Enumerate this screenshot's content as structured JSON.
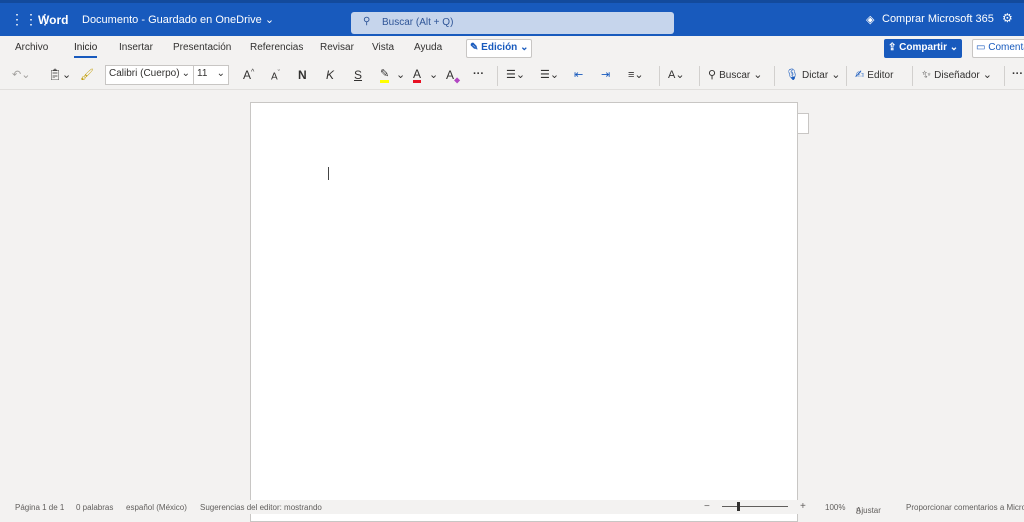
{
  "header": {
    "app_name": "Word",
    "doc_title": "Documento",
    "separator": "-",
    "save_status": "Guardado en OneDrive",
    "search_placeholder": "Buscar (Alt + Q)",
    "buy_label": "Comprar Microsoft 365"
  },
  "tabs": [
    {
      "label": "Archivo"
    },
    {
      "label": "Inicio",
      "active": true
    },
    {
      "label": "Insertar"
    },
    {
      "label": "Presentación"
    },
    {
      "label": "Referencias"
    },
    {
      "label": "Revisar"
    },
    {
      "label": "Vista"
    },
    {
      "label": "Ayuda"
    }
  ],
  "mode_label": "Edición",
  "share_label": "Compartir",
  "comments_label": "Comentarios",
  "toolbar": {
    "font": "Calibri (Cuerpo)",
    "size": "11",
    "bold": "N",
    "italic": "K",
    "underline": "S",
    "grow": "A",
    "shrink": "A",
    "more": "···",
    "search": "Buscar",
    "dictate": "Dictar",
    "editor": "Editor",
    "designer": "Diseñador"
  },
  "status": {
    "page": "Página 1 de 1",
    "words": "0 palabras",
    "language": "español (México)",
    "suggestions": "Sugerencias del editor: mostrando",
    "zoom_minus": "−",
    "zoom_plus": "+",
    "zoom": "100%",
    "fit": "Ajustar",
    "feedback": "Proporcionar comentarios a Microsoft"
  },
  "colors": {
    "brand": "#185abd",
    "highlight": "#ffff00",
    "font_color": "#e81123"
  }
}
